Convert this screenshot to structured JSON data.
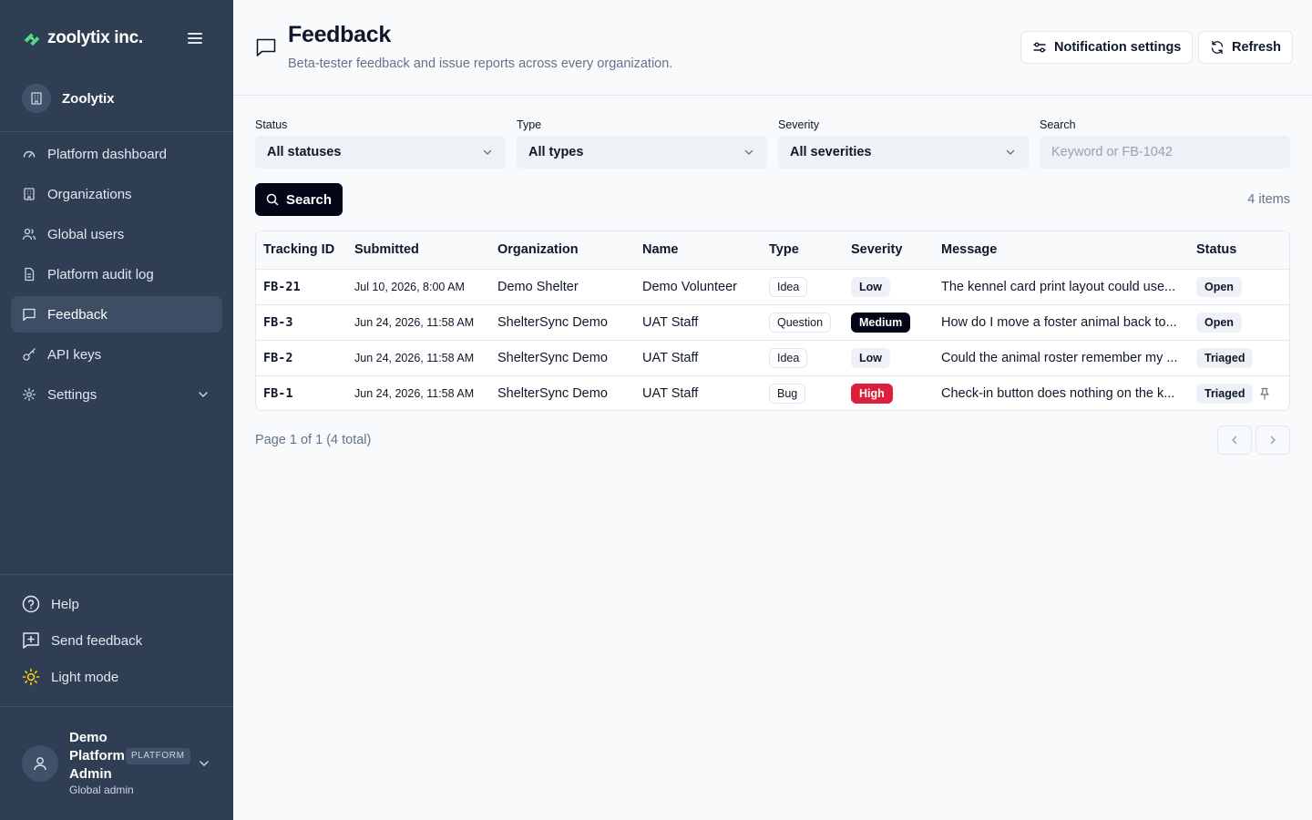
{
  "brand": {
    "name": "zoolytix inc.",
    "logo_icon": "leaf-logo-icon",
    "accent": "#4ade80"
  },
  "sidebar": {
    "org_name": "Zoolytix",
    "nav": [
      {
        "label": "Platform dashboard",
        "icon": "gauge-icon"
      },
      {
        "label": "Organizations",
        "icon": "building-icon"
      },
      {
        "label": "Global users",
        "icon": "users-icon"
      },
      {
        "label": "Platform audit log",
        "icon": "file-icon"
      },
      {
        "label": "Feedback",
        "icon": "message-square-icon",
        "active": true
      },
      {
        "label": "API keys",
        "icon": "key-icon"
      },
      {
        "label": "Settings",
        "icon": "gear-icon"
      }
    ],
    "bottom": [
      {
        "label": "Help",
        "icon": "help-circle-icon"
      },
      {
        "label": "Send feedback",
        "icon": "plus-square-icon"
      },
      {
        "label": "Light mode",
        "icon": "sun-icon"
      }
    ],
    "user": {
      "name": "Demo Platform Admin",
      "badge": "PLATFORM",
      "role": "Global admin"
    }
  },
  "header": {
    "title": "Feedback",
    "subtitle": "Beta-tester feedback and issue reports across every organization.",
    "notification_btn": "Notification settings",
    "refresh_btn": "Refresh"
  },
  "filters": {
    "status": {
      "label": "Status",
      "value": "All statuses"
    },
    "type": {
      "label": "Type",
      "value": "All types"
    },
    "severity": {
      "label": "Severity",
      "value": "All severities"
    },
    "search": {
      "label": "Search",
      "placeholder": "Keyword or FB-1042",
      "value": ""
    }
  },
  "search_btn": "Search",
  "items_count": "4 items",
  "table": {
    "headers": [
      "Tracking ID",
      "Submitted",
      "Organization",
      "Name",
      "Type",
      "Severity",
      "Message",
      "Status"
    ],
    "rows": [
      {
        "id": "FB-21",
        "submitted": "Jul 10, 2026, 8:00 AM",
        "org": "Demo Shelter",
        "name": "Demo Volunteer",
        "type": "Idea",
        "severity": "Low",
        "message": "The kennel card print layout could use...",
        "status": "Open",
        "pinned": false
      },
      {
        "id": "FB-3",
        "submitted": "Jun 24, 2026, 11:58 AM",
        "org": "ShelterSync Demo",
        "name": "UAT Staff",
        "type": "Question",
        "severity": "Medium",
        "message": "How do I move a foster animal back to...",
        "status": "Open",
        "pinned": false
      },
      {
        "id": "FB-2",
        "submitted": "Jun 24, 2026, 11:58 AM",
        "org": "ShelterSync Demo",
        "name": "UAT Staff",
        "type": "Idea",
        "severity": "Low",
        "message": "Could the animal roster remember my ...",
        "status": "Triaged",
        "pinned": false
      },
      {
        "id": "FB-1",
        "submitted": "Jun 24, 2026, 11:58 AM",
        "org": "ShelterSync Demo",
        "name": "UAT Staff",
        "type": "Bug",
        "severity": "High",
        "message": "Check-in button does nothing on the k...",
        "status": "Triaged",
        "pinned": true
      }
    ]
  },
  "pager": {
    "text": "Page 1 of 1 (4 total)"
  },
  "colors": {
    "sidebar_bg": "#2f3e52",
    "high": "#dc1f3c",
    "medium": "#020617"
  }
}
